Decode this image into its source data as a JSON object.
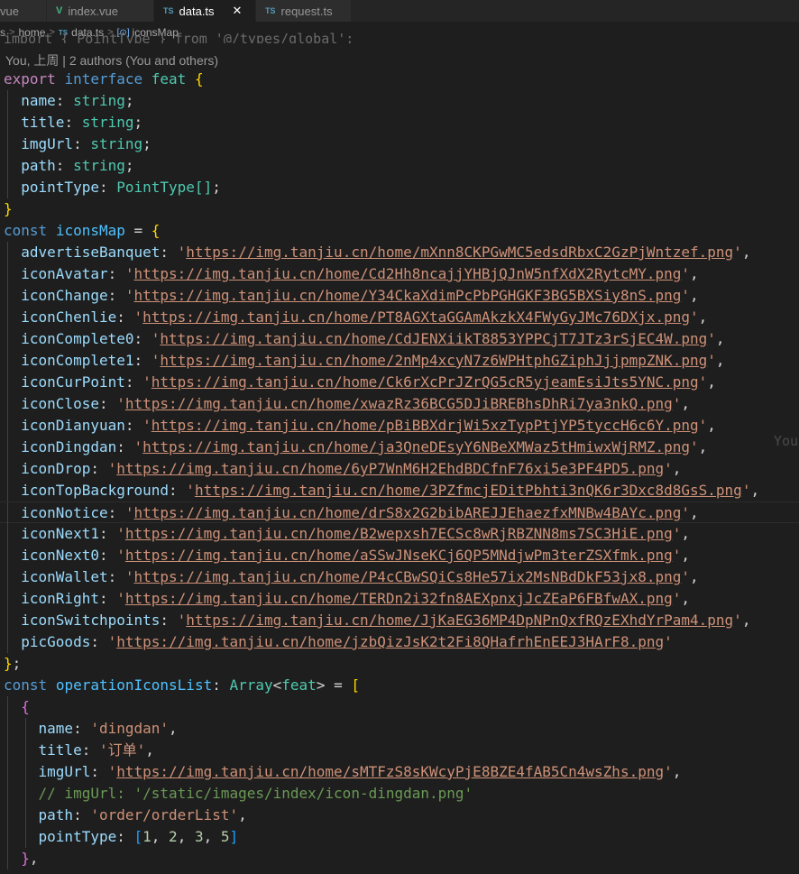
{
  "tabs": [
    {
      "icon": "vue-icon",
      "label": "vue",
      "active": false
    },
    {
      "icon": "vue-icon",
      "label": "index.vue",
      "active": false
    },
    {
      "icon": "ts-icon",
      "label": "data.ts",
      "active": true
    },
    {
      "icon": "ts-icon",
      "label": "request.ts",
      "active": false
    }
  ],
  "tab_icons": {
    "vue": "V",
    "ts": "TS",
    "close": "✕"
  },
  "breadcrumb": {
    "folder0": "s",
    "folder1": "home",
    "file": "data.ts",
    "symbol": "iconsMap",
    "symbol_icon": "[⊙]"
  },
  "import_line": "import { PointType } from '@/types/global';",
  "codelens": "You, 上周 | 2 authors (You and others)",
  "blame_ghost": "You",
  "code": {
    "export_kw": "export",
    "interface_kw": "interface",
    "feat_name": "feat",
    "fields": [
      {
        "key": "name",
        "type": "string"
      },
      {
        "key": "title",
        "type": "string"
      },
      {
        "key": "imgUrl",
        "type": "string"
      },
      {
        "key": "path",
        "type": "string"
      }
    ],
    "pointType": {
      "key": "pointType",
      "type": "PointType[]"
    },
    "const_kw": "const",
    "iconsMap_name": "iconsMap",
    "icons": [
      {
        "key": "advertiseBanquet",
        "url": "https://img.tanjiu.cn/home/mXnn8CKPGwMC5edsdRbxC2GzPjWntzef.png"
      },
      {
        "key": "iconAvatar",
        "url": "https://img.tanjiu.cn/home/Cd2Hh8ncajjYHBjQJnW5nfXdX2RytcMY.png"
      },
      {
        "key": "iconChange",
        "url": "https://img.tanjiu.cn/home/Y34CkaXdimPcPbPGHGKF3BG5BXSiy8nS.png"
      },
      {
        "key": "iconChenlie",
        "url": "https://img.tanjiu.cn/home/PT8AGXtaGGAmAkzkX4FWyGyJMc76DXjx.png"
      },
      {
        "key": "iconComplete0",
        "url": "https://img.tanjiu.cn/home/CdJENXiikT8853YPPCjT7JTz3rSjEC4W.png"
      },
      {
        "key": "iconComplete1",
        "url": "https://img.tanjiu.cn/home/2nMp4xcyN7z6WPHtphGZiphJjjpmpZNK.png"
      },
      {
        "key": "iconCurPoint",
        "url": "https://img.tanjiu.cn/home/Ck6rXcPrJZrQG5cR5yjeamEsiJts5YNC.png"
      },
      {
        "key": "iconClose",
        "url": "https://img.tanjiu.cn/home/xwazRz36BCG5DJiBREBhsDhRi7ya3nkQ.png"
      },
      {
        "key": "iconDianyuan",
        "url": "https://img.tanjiu.cn/home/pBiBBXdrjWi5xzTypPtjYP5tyccH6c6Y.png"
      },
      {
        "key": "iconDingdan",
        "url": "https://img.tanjiu.cn/home/ja3QneDEsyY6NBeXMWaz5tHmiwxWjRMZ.png"
      },
      {
        "key": "iconDrop",
        "url": "https://img.tanjiu.cn/home/6yP7WnM6H2EhdBDCfnF76xi5e3PF4PD5.png"
      },
      {
        "key": "iconTopBackground",
        "url": "https://img.tanjiu.cn/home/3PZfmcjEDitPbhti3nQK6r3Dxc8d8GsS.png"
      },
      {
        "key": "iconNotice",
        "url": "https://img.tanjiu.cn/home/drS8x2G2bibAREJJEhaezfxMNBw4BAYc.png"
      },
      {
        "key": "iconNext1",
        "url": "https://img.tanjiu.cn/home/B2wepxsh7ECSc8wRjRBZNN8ms7SC3HiE.png"
      },
      {
        "key": "iconNext0",
        "url": "https://img.tanjiu.cn/home/aSSwJNseKCj6QP5MNdjwPm3terZSXfmk.png"
      },
      {
        "key": "iconWallet",
        "url": "https://img.tanjiu.cn/home/P4cCBwSQiCs8He57ix2MsNBdDkF53jx8.png"
      },
      {
        "key": "iconRight",
        "url": "https://img.tanjiu.cn/home/TERDn2i32fn8AEXpnxjJcZEaP6FBfwAX.png"
      },
      {
        "key": "iconSwitchpoints",
        "url": "https://img.tanjiu.cn/home/JjKaEG36MP4DpNPnQxfRQzEXhdYrPam4.png"
      },
      {
        "key": "picGoods",
        "url": "https://img.tanjiu.cn/home/jzbQizJsK2t2Fi8QHafrhEnEEJ3HArF8.png"
      }
    ],
    "opList": {
      "name": "operationIconsList",
      "type_array": "Array",
      "type_param": "feat"
    },
    "item": {
      "name_key": "name",
      "name_val": "'dingdan'",
      "title_key": "title",
      "title_val": "'订单'",
      "imgUrl_key": "imgUrl",
      "imgUrl_val": "https://img.tanjiu.cn/home/sMTFzS8sKWcyPjE8BZE4fAB5Cn4wsZhs.png",
      "comment": "// imgUrl: '/static/images/index/icon-dingdan.png'",
      "path_key": "path",
      "path_val": "'order/orderList'",
      "pointType_key": "pointType",
      "pointType_vals": [
        "1",
        "2",
        "3",
        "5"
      ]
    }
  }
}
